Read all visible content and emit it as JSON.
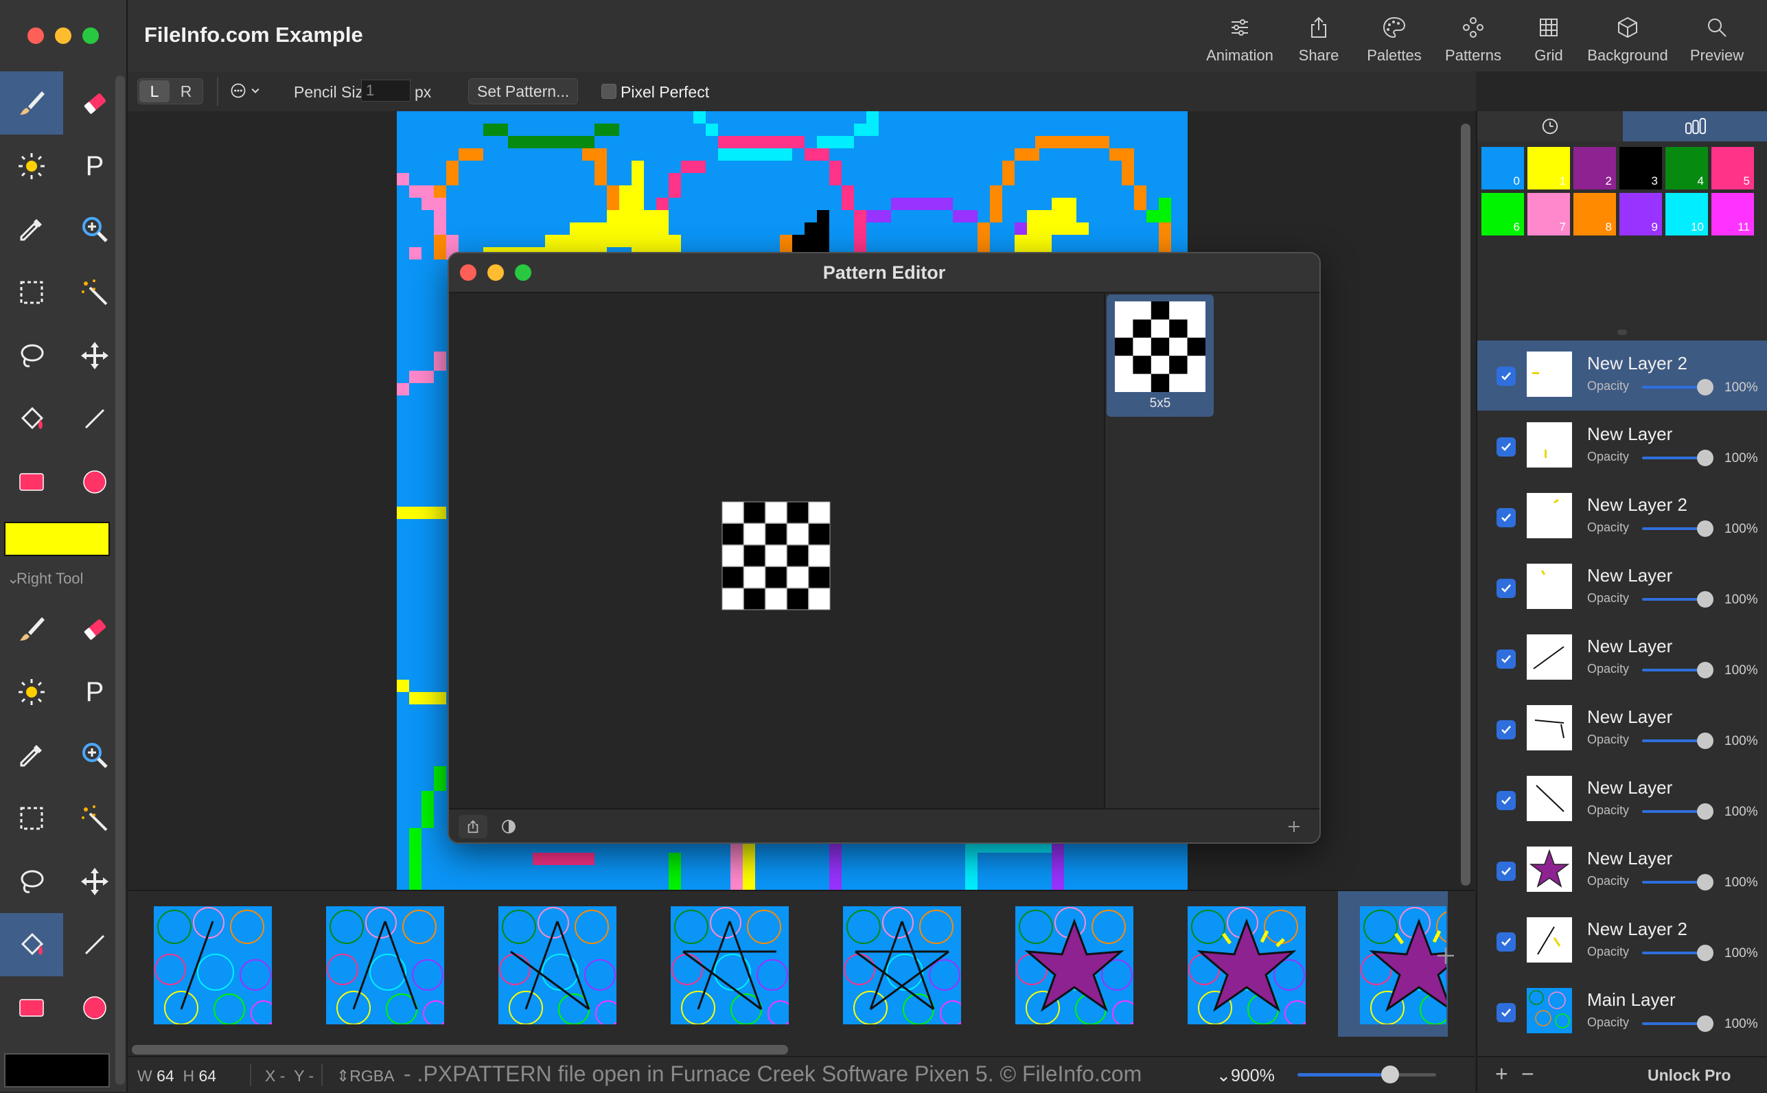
{
  "app": {
    "title": "FileInfo.com Example"
  },
  "toolbar_top": {
    "buttons": [
      {
        "label": "Animation",
        "icon": "sliders-icon"
      },
      {
        "label": "Share",
        "icon": "share-icon"
      },
      {
        "label": "Palettes",
        "icon": "palette-icon"
      },
      {
        "label": "Patterns",
        "icon": "patterns-icon"
      },
      {
        "label": "Grid",
        "icon": "grid-icon"
      },
      {
        "label": "Background",
        "icon": "cube-icon"
      },
      {
        "label": "Preview",
        "icon": "search-icon"
      }
    ]
  },
  "options": {
    "left_label": "L",
    "right_label": "R",
    "pencil_size_label": "Pencil Size:",
    "pencil_size_value": "1",
    "pencil_size_unit": "px",
    "set_pattern_label": "Set Pattern...",
    "pixel_perfect_label": "Pixel Perfect",
    "pixel_perfect_checked": false
  },
  "left_tools": {
    "left_tool_color": "#ffff00",
    "right_tool_label": "Right Tool",
    "right_tool_color": "#000000",
    "letter_tool": "P"
  },
  "pattern_editor": {
    "title": "Pattern Editor",
    "pattern_size_label": "5x5",
    "pattern": [
      [
        0,
        1,
        0,
        1,
        0
      ],
      [
        1,
        0,
        1,
        0,
        1
      ],
      [
        0,
        1,
        0,
        1,
        0
      ],
      [
        1,
        0,
        1,
        0,
        1
      ],
      [
        0,
        1,
        0,
        1,
        0
      ]
    ],
    "thumbnail_pattern": [
      [
        0,
        0,
        1,
        0,
        0
      ],
      [
        0,
        1,
        0,
        1,
        0
      ],
      [
        1,
        0,
        1,
        0,
        1
      ],
      [
        0,
        1,
        0,
        1,
        0
      ],
      [
        0,
        0,
        1,
        0,
        0
      ]
    ]
  },
  "palette": {
    "colors": [
      {
        "index": "0",
        "hex": "#0a95f7"
      },
      {
        "index": "1",
        "hex": "#ffff00"
      },
      {
        "index": "2",
        "hex": "#8e2291"
      },
      {
        "index": "3",
        "hex": "#000000"
      },
      {
        "index": "4",
        "hex": "#078a10"
      },
      {
        "index": "5",
        "hex": "#ff3388"
      },
      {
        "index": "6",
        "hex": "#00f400"
      },
      {
        "index": "7",
        "hex": "#ff88cc"
      },
      {
        "index": "8",
        "hex": "#ff8a00"
      },
      {
        "index": "9",
        "hex": "#9933ff"
      },
      {
        "index": "10",
        "hex": "#00eeff"
      },
      {
        "index": "11",
        "hex": "#ff33ff"
      }
    ]
  },
  "layers": [
    {
      "name": "New Layer 2",
      "opacity_label": "Opacity",
      "opacity": "100%",
      "selected": true,
      "thumb": "yellow-dash"
    },
    {
      "name": "New Layer",
      "opacity_label": "Opacity",
      "opacity": "100%",
      "selected": false,
      "thumb": "yellow-small"
    },
    {
      "name": "New Layer 2",
      "opacity_label": "Opacity",
      "opacity": "100%",
      "selected": false,
      "thumb": "yellow-tick"
    },
    {
      "name": "New Layer",
      "opacity_label": "Opacity",
      "opacity": "100%",
      "selected": false,
      "thumb": "yellow-dot"
    },
    {
      "name": "New Layer",
      "opacity_label": "Opacity",
      "opacity": "100%",
      "selected": false,
      "thumb": "black-diag"
    },
    {
      "name": "New Layer",
      "opacity_label": "Opacity",
      "opacity": "100%",
      "selected": false,
      "thumb": "black-flat"
    },
    {
      "name": "New Layer",
      "opacity_label": "Opacity",
      "opacity": "100%",
      "selected": false,
      "thumb": "black-steep"
    },
    {
      "name": "New Layer",
      "opacity_label": "Opacity",
      "opacity": "100%",
      "selected": false,
      "thumb": "purple-star"
    },
    {
      "name": "New Layer 2",
      "opacity_label": "Opacity",
      "opacity": "100%",
      "selected": false,
      "thumb": "black-yellow"
    },
    {
      "name": "Main Layer",
      "opacity_label": "Opacity",
      "opacity": "100%",
      "selected": false,
      "thumb": "main"
    }
  ],
  "frames": {
    "count": 8,
    "selected_index": 7
  },
  "status": {
    "w_label": "W",
    "w_value": "64",
    "h_label": "H",
    "h_value": "64",
    "x_label": "X",
    "x_value": "-",
    "y_label": "Y",
    "y_value": "-",
    "color_mode": "RGBA",
    "separator": "-",
    "message": ".PXPATTERN file open in Furnace Creek Software Pixen 5. © FileInfo.com",
    "zoom": "900%",
    "zoom_fraction": 0.67
  },
  "right_footer": {
    "add_label": "+",
    "remove_label": "−",
    "unlock_label": "Unlock Pro"
  }
}
